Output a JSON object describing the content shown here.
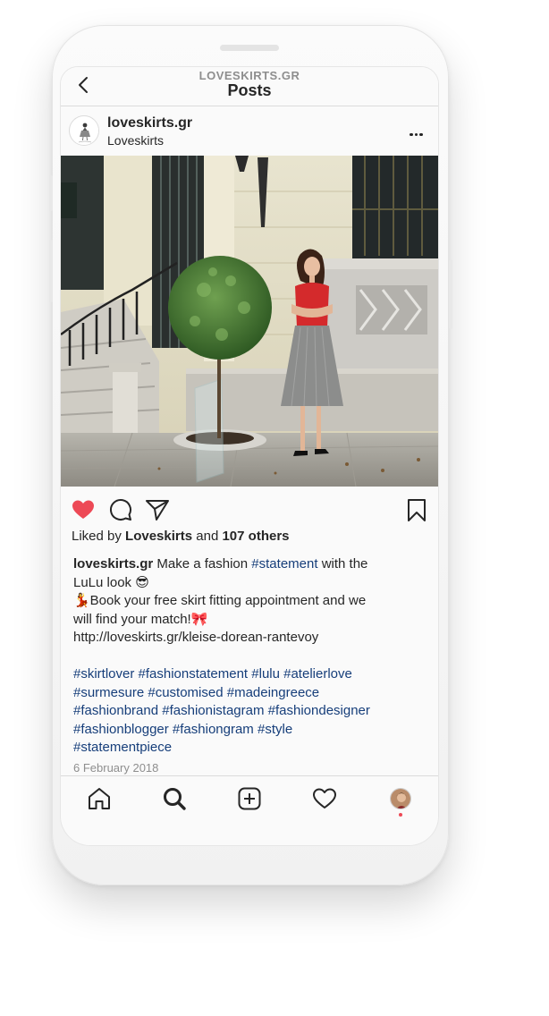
{
  "header": {
    "account_label": "LOVESKIRTS.GR",
    "title": "Posts",
    "back_icon": "chevron-left-icon"
  },
  "post": {
    "username": "loveskirts.gr",
    "location": "Loveskirts",
    "more_icon": "ellipsis-icon",
    "image": "woman in red top and grey pleated skirt beside a small round tree in front of a neoclassical building",
    "liked_by_prefix": "Liked by",
    "liked_by_user": "Loveskirts",
    "liked_by_and": "and",
    "liked_by_others": "107 others",
    "caption": {
      "username": "loveskirts.gr",
      "text_1": "Make a fashion",
      "tag_1": "#statement",
      "text_2": "with the",
      "line_2": "LuLu look 😎",
      "line_3": "💃Book your free skirt fitting appointment and we",
      "line_4": "will find your match!🎀",
      "link": "http://loveskirts.gr/kleise-dorean-rantevoy",
      "hashtag_lines": [
        "#skirtlover #fashionstatement #lulu #atelierlove",
        "#surmesure #customised #madeingreece",
        "#fashionbrand #fashionistagram #fashiondesigner",
        "#fashionblogger #fashiongram #style",
        "#statementpiece"
      ]
    },
    "date": "6 February 2018"
  },
  "actions": {
    "like_icon": "heart-filled-icon",
    "comment_icon": "comment-icon",
    "share_icon": "paper-plane-icon",
    "save_icon": "bookmark-icon",
    "like_color": "#ed4956"
  },
  "bottom_nav": {
    "items": [
      "home-icon",
      "search-icon",
      "add-post-icon",
      "activity-heart-icon",
      "profile-avatar"
    ]
  },
  "colors": {
    "hashtag": "#163e7a",
    "secondary_text": "#8e8e8e",
    "divider": "#dbdbdb"
  }
}
